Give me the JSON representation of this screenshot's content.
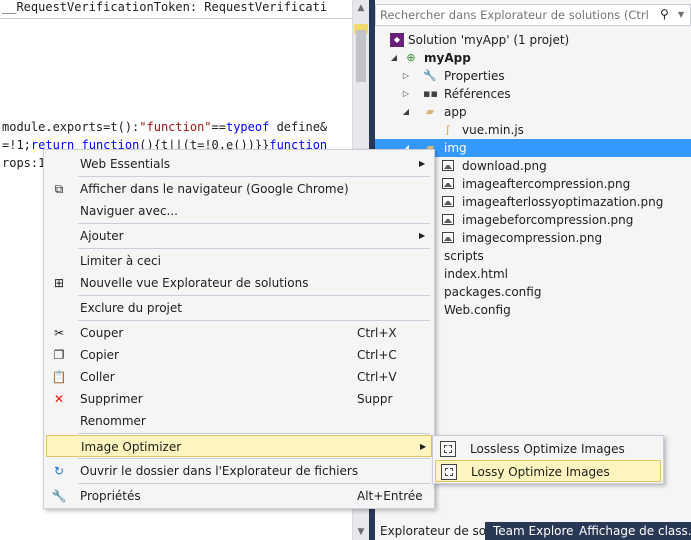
{
  "editor": {
    "line1": "__RequestVerificationToken: RequestVerificati",
    "line2_parts": [
      "module.exports=t():",
      "\"function\"",
      "==",
      "typeof",
      " define&"
    ],
    "line3_parts": [
      "=!1;",
      "return",
      " ",
      "function",
      "(){t||(t=!0,e())}}",
      "function"
    ],
    "line4": "rops:1"
  },
  "solution_explorer": {
    "search_placeholder": "Rechercher dans Explorateur de solutions (Ctrl+$)",
    "search_icon": "search-icon",
    "tree": [
      {
        "label": "Solution 'myApp' (1 projet)",
        "icon": "solution-icon"
      },
      {
        "label": "myApp",
        "icon": "web-project-icon"
      },
      {
        "label": "Properties",
        "icon": "wrench-icon"
      },
      {
        "label": "Références",
        "icon": "references-icon"
      },
      {
        "label": "app",
        "icon": "folder-open-icon"
      },
      {
        "label": "vue.min.js",
        "icon": "js-file-icon"
      },
      {
        "label": "img",
        "icon": "folder-open-icon"
      },
      {
        "label": "download.png",
        "icon": "image-file-icon"
      },
      {
        "label": "imageaftercompression.png",
        "icon": "image-file-icon"
      },
      {
        "label": "imageafterlossyoptimazation.png",
        "icon": "image-file-icon"
      },
      {
        "label": "imagebeforcompression.png",
        "icon": "image-file-icon"
      },
      {
        "label": "imagecompression.png",
        "icon": "image-file-icon"
      },
      {
        "label": "scripts",
        "icon": "folder-icon"
      },
      {
        "label": "index.html",
        "icon": "html-file-icon"
      },
      {
        "label": "packages.config",
        "icon": "config-file-icon"
      },
      {
        "label": "Web.config",
        "icon": "config-file-icon"
      }
    ],
    "tabs": [
      {
        "label": "Explorateur de sol..."
      },
      {
        "label": "Team Explorer"
      },
      {
        "label": "Affichage de class..."
      }
    ]
  },
  "context_menu": {
    "items": [
      {
        "label": "Web Essentials",
        "shortcut": "",
        "icon": ""
      },
      {
        "label": "Afficher dans le navigateur (Google Chrome)",
        "shortcut": "",
        "icon": "browser-icon"
      },
      {
        "label": "Naviguer avec...",
        "shortcut": "",
        "icon": ""
      },
      {
        "label": "Ajouter",
        "shortcut": "",
        "icon": ""
      },
      {
        "label": "Limiter à ceci",
        "shortcut": "",
        "icon": ""
      },
      {
        "label": "Nouvelle vue Explorateur de solutions",
        "shortcut": "",
        "icon": "new-view-icon"
      },
      {
        "label": "Exclure du projet",
        "shortcut": "",
        "icon": ""
      },
      {
        "label": "Couper",
        "shortcut": "Ctrl+X",
        "icon": "scissors-icon"
      },
      {
        "label": "Copier",
        "shortcut": "Ctrl+C",
        "icon": "copy-icon"
      },
      {
        "label": "Coller",
        "shortcut": "Ctrl+V",
        "icon": "paste-icon"
      },
      {
        "label": "Supprimer",
        "shortcut": "Suppr",
        "icon": "delete-icon"
      },
      {
        "label": "Renommer",
        "shortcut": "",
        "icon": ""
      },
      {
        "label": "Image Optimizer",
        "shortcut": "",
        "icon": ""
      },
      {
        "label": "Ouvrir le dossier dans l'Explorateur de fichiers",
        "shortcut": "",
        "icon": "refresh-icon"
      },
      {
        "label": "Propriétés",
        "shortcut": "Alt+Entrée",
        "icon": "wrench-icon"
      }
    ]
  },
  "submenu": {
    "items": [
      {
        "label": "Lossless Optimize Images",
        "icon": "optimize-icon"
      },
      {
        "label": "Lossy Optimize Images",
        "icon": "optimize-icon"
      }
    ]
  },
  "colors": {
    "selection": "#3399ff",
    "menu_highlight": "#fdf4bf",
    "menu_highlight_border": "#e5c365",
    "tab_bar": "#293955",
    "keyword": "#0000ff",
    "string": "#a31515"
  }
}
